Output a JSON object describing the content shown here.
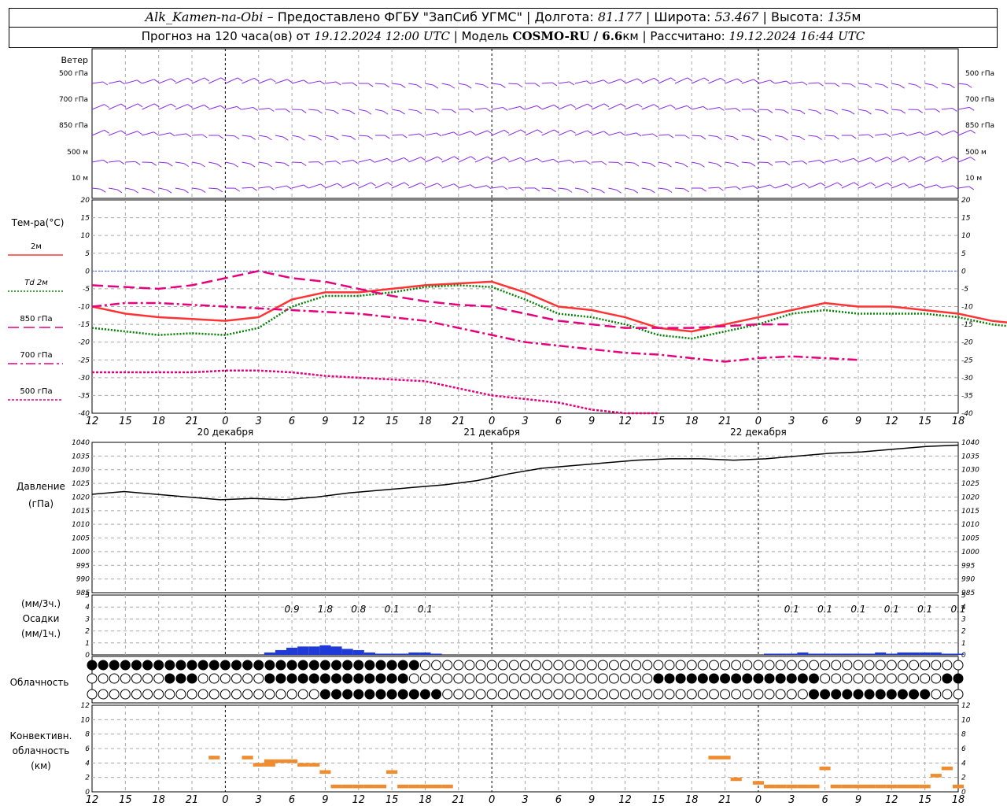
{
  "header": {
    "station": "Alk_Kamen-na-Obi",
    "provider": "– Предоставлено ФГБУ \"ЗапСиб УГМС\"",
    "lon_label": "Долгота:",
    "lon": "81.177",
    "lat_label": "Широта:",
    "lat": "53.467",
    "alt_label": "Высота:",
    "alt": "135",
    "alt_unit": "м",
    "forecast_label": "Прогноз на 120 часа(ов) от",
    "forecast_time": "19.12.2024 12:00 UTC",
    "model_label": "Модель",
    "model": "COSMO-RU / 6.6",
    "model_unit": "км",
    "calc_label": "Рассчитано:",
    "calc_time": "19.12.2024 16:44 UTC"
  },
  "wind_panel": {
    "title": "Ветер",
    "levels": [
      "500 гПа",
      "700 гПа",
      "850 гПа",
      "500 м",
      "10  м"
    ],
    "color": "#8a2be2"
  },
  "temp_panel": {
    "title": "Тем-ра(°C)",
    "legend": [
      {
        "label": "2м",
        "color": "#ff3333",
        "dash": "solid"
      },
      {
        "label": "Td  2м",
        "color": "#008000",
        "dash": "dotted"
      },
      {
        "label": "850 гПа",
        "color": "#e6007e",
        "dash": "longdash"
      },
      {
        "label": "700 гПа",
        "color": "#e6007e",
        "dash": "dashdot"
      },
      {
        "label": "500 гПа",
        "color": "#e6007e",
        "dash": "dense"
      }
    ],
    "ticks": [
      "20",
      "15",
      "10",
      "5",
      "0",
      "-5",
      "-10",
      "-15",
      "-20",
      "-25",
      "-30",
      "-35",
      "-40"
    ]
  },
  "pressure_panel": {
    "title": "Давление",
    "unit": "(гПа)",
    "ticks": [
      "1040",
      "1035",
      "1030",
      "1025",
      "1020",
      "1015",
      "1010",
      "1005",
      "1000",
      "995",
      "990",
      "985"
    ]
  },
  "precip_panel": {
    "unit_top": "(мм/3ч.)",
    "title": "Осадки",
    "unit_bottom": "(мм/1ч.)",
    "ticks": [
      "5",
      "4",
      "3",
      "2",
      "1",
      "0"
    ],
    "labels": [
      {
        "h": 18,
        "text": "0.9"
      },
      {
        "h": 21,
        "text": "1.8"
      },
      {
        "h": 24,
        "text": "0.8"
      },
      {
        "h": 27,
        "text": "0.1"
      },
      {
        "h": 30,
        "text": "0.1"
      },
      {
        "h": 63,
        "text": "0.1"
      },
      {
        "h": 66,
        "text": "0.1"
      },
      {
        "h": 69,
        "text": "0.1"
      },
      {
        "h": 72,
        "text": "0.1"
      },
      {
        "h": 75,
        "text": "0.1"
      },
      {
        "h": 78,
        "text": "0.1"
      }
    ]
  },
  "cloud_panel": {
    "title": "Облачность"
  },
  "conv_panel": {
    "title1": "Конвективн.",
    "title2": "облачность",
    "unit": "(км)",
    "ticks": [
      "12",
      "10",
      "8",
      "6",
      "4",
      "2",
      "0"
    ],
    "color": "#f08c30"
  },
  "time_axis": {
    "labels": [
      "12",
      "15",
      "18",
      "21",
      "0",
      "3",
      "6",
      "9",
      "12",
      "15",
      "18",
      "21",
      "0",
      "3",
      "6",
      "9",
      "12",
      "15",
      "18",
      "21",
      "0",
      "3",
      "6",
      "9",
      "12",
      "15",
      "18"
    ],
    "days": [
      "20 декабря",
      "21 декабря",
      "22 декабря"
    ]
  },
  "chart_data": [
    {
      "type": "line",
      "title": "Тем-ра(°C)",
      "x_hours": [
        0,
        3,
        6,
        9,
        12,
        15,
        18,
        21,
        24,
        27,
        30,
        33,
        36,
        39,
        42,
        45,
        48,
        51,
        54,
        57,
        60,
        63,
        66,
        69,
        72,
        75,
        78
      ],
      "ylim": [
        -40,
        20
      ],
      "series": [
        {
          "name": "2м",
          "values": [
            -10,
            -12,
            -13,
            -13.5,
            -14,
            -13,
            -8,
            -6,
            -6,
            -5,
            -4,
            -3.5,
            -3,
            -6,
            -10,
            -11,
            -13,
            -16,
            -17,
            -15,
            -13,
            -11,
            -9,
            -10,
            -10,
            -11,
            -12,
            -14,
            -15
          ]
        },
        {
          "name": "Td  2м",
          "values": [
            -16,
            -17,
            -18,
            -17.5,
            -18,
            -16,
            -10,
            -7,
            -7,
            -6,
            -4.5,
            -4,
            -4.5,
            -8,
            -12,
            -13,
            -15,
            -18,
            -19,
            -17,
            -15,
            -12,
            -11,
            -12,
            -12,
            -12,
            -13,
            -15,
            -16
          ]
        },
        {
          "name": "850 гПа",
          "values": [
            -4,
            -4.5,
            -5,
            -4,
            -2,
            0,
            -2,
            -3,
            -5,
            -7,
            -8.5,
            -9.5,
            -10,
            -12,
            -14,
            -15,
            -16,
            -16,
            -16,
            -15.5,
            -15,
            -15
          ]
        },
        {
          "name": "700 гПа",
          "values": [
            -10,
            -9,
            -9,
            -9.5,
            -10,
            -10.5,
            -11,
            -11.5,
            -12,
            -13,
            -14,
            -16,
            -18,
            -20,
            -21,
            -22,
            -23,
            -23.5,
            -24.5,
            -25.5,
            -24.5,
            -24,
            -24.5,
            -25
          ]
        },
        {
          "name": "500 гПа",
          "values": [
            -28.5,
            -28.5,
            -28.5,
            -28.5,
            -28,
            -28,
            -28.5,
            -29.5,
            -30,
            -30.5,
            -31,
            -33,
            -35,
            -36,
            -37,
            -39,
            -40,
            -41
          ]
        }
      ]
    },
    {
      "type": "line",
      "title": "Давление",
      "x_hours": [
        0,
        3,
        6,
        9,
        12,
        15,
        18,
        21,
        24,
        27,
        30,
        33,
        36,
        39,
        42,
        45,
        48,
        51,
        54,
        57,
        60,
        63,
        66,
        69,
        72,
        75,
        78
      ],
      "ylim": [
        985,
        1040
      ],
      "series": [
        {
          "name": "Давление",
          "values": [
            1021,
            1022,
            1021,
            1020,
            1019,
            1019.5,
            1019,
            1020,
            1021.5,
            1022.5,
            1023.5,
            1024.5,
            1026,
            1028.5,
            1030.5,
            1031.5,
            1032.5,
            1033.5,
            1034,
            1034,
            1033.5,
            1034,
            1035,
            1036,
            1036.5,
            1037.5,
            1038.5,
            1039
          ]
        }
      ]
    },
    {
      "type": "bar",
      "title": "Осадки",
      "x_hours": [
        16,
        17,
        18,
        19,
        20,
        21,
        22,
        23,
        24,
        25,
        26,
        27,
        28,
        29,
        30,
        31,
        61,
        62,
        63,
        64,
        65,
        66,
        67,
        68,
        69,
        70,
        71,
        72,
        73,
        74,
        75,
        76,
        77,
        78
      ],
      "ylim": [
        0,
        5
      ],
      "values": [
        0.2,
        0.4,
        0.6,
        0.7,
        0.7,
        0.8,
        0.7,
        0.5,
        0.4,
        0.2,
        0.1,
        0.1,
        0.1,
        0.2,
        0.2,
        0.1,
        0.1,
        0.1,
        0.1,
        0.2,
        0.1,
        0.1,
        0.1,
        0.1,
        0.1,
        0.1,
        0.2,
        0.1,
        0.2,
        0.2,
        0.2,
        0.2,
        0.1,
        0.1
      ]
    }
  ]
}
